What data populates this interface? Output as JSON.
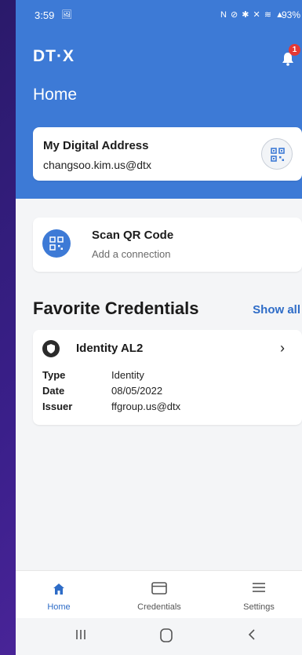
{
  "status": {
    "time": "3:59",
    "time_icon": "🖼",
    "icons": "N ⊘ ✱ ✕ ≋ ▲",
    "battery": "93%"
  },
  "app": {
    "logo": "DT·X",
    "notification_count": "1",
    "page_title": "Home"
  },
  "address": {
    "label": "My Digital Address",
    "value": "changsoo.kim.us@dtx"
  },
  "scan": {
    "title": "Scan QR Code",
    "subtitle": "Add a connection"
  },
  "favorites": {
    "title": "Favorite Credentials",
    "show_all": "Show all",
    "credential": {
      "title": "Identity AL2",
      "rows": [
        {
          "key": "Type",
          "value": "Identity"
        },
        {
          "key": "Date",
          "value": "08/05/2022"
        },
        {
          "key": "Issuer",
          "value": "ffgroup.us@dtx"
        }
      ]
    }
  },
  "nav": [
    {
      "label": "Home",
      "icon": "home-icon",
      "active": true
    },
    {
      "label": "Credentials",
      "icon": "credit-card-icon",
      "active": false
    },
    {
      "label": "Settings",
      "icon": "menu-icon",
      "active": false
    }
  ],
  "colors": {
    "primary": "#3d7ad6",
    "link": "#2e6cc7",
    "badge": "#e53935"
  }
}
